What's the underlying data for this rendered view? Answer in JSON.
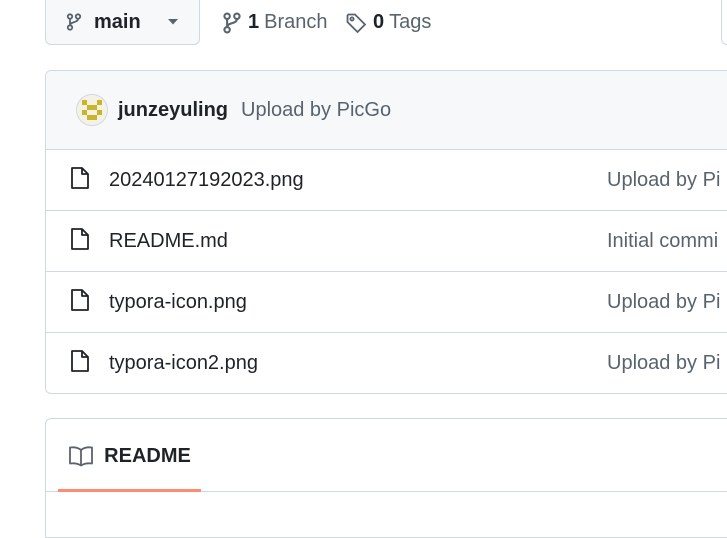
{
  "branch": {
    "name": "main",
    "icon": "git-branch-icon"
  },
  "meta": {
    "branches_count": "1",
    "branches_label": "Branch",
    "tags_count": "0",
    "tags_label": "Tags"
  },
  "latest_commit": {
    "author": "junzeyuling",
    "message": "Upload by PicGo"
  },
  "files": [
    {
      "name": "20240127192023.png",
      "commit": "Upload by Pi"
    },
    {
      "name": "README.md",
      "commit": "Initial commi"
    },
    {
      "name": "typora-icon.png",
      "commit": "Upload by Pi"
    },
    {
      "name": "typora-icon2.png",
      "commit": "Upload by Pi"
    }
  ],
  "readme": {
    "tab_label": "README"
  },
  "colors": {
    "accent_underline": "#fd8c73",
    "border": "#d1d9e0",
    "muted_text": "#59636e"
  }
}
